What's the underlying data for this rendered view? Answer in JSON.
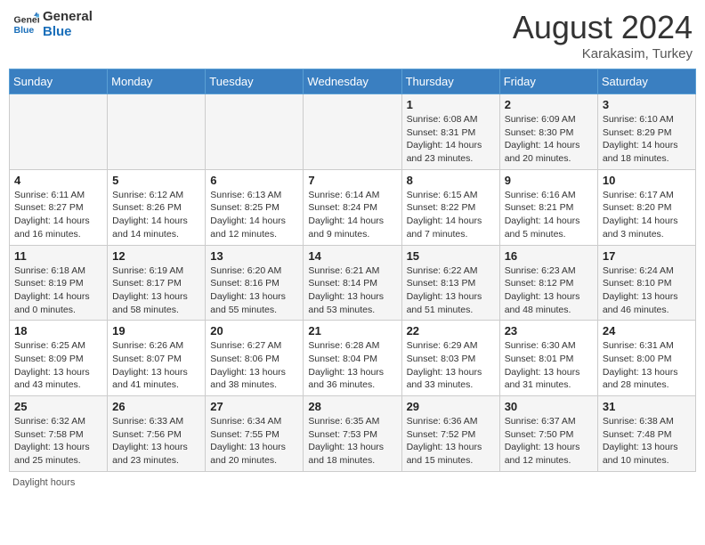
{
  "header": {
    "logo_line1": "General",
    "logo_line2": "Blue",
    "month_year": "August 2024",
    "location": "Karakasim, Turkey"
  },
  "days_of_week": [
    "Sunday",
    "Monday",
    "Tuesday",
    "Wednesday",
    "Thursday",
    "Friday",
    "Saturday"
  ],
  "weeks": [
    [
      {
        "day": "",
        "info": ""
      },
      {
        "day": "",
        "info": ""
      },
      {
        "day": "",
        "info": ""
      },
      {
        "day": "",
        "info": ""
      },
      {
        "day": "1",
        "info": "Sunrise: 6:08 AM\nSunset: 8:31 PM\nDaylight: 14 hours and 23 minutes."
      },
      {
        "day": "2",
        "info": "Sunrise: 6:09 AM\nSunset: 8:30 PM\nDaylight: 14 hours and 20 minutes."
      },
      {
        "day": "3",
        "info": "Sunrise: 6:10 AM\nSunset: 8:29 PM\nDaylight: 14 hours and 18 minutes."
      }
    ],
    [
      {
        "day": "4",
        "info": "Sunrise: 6:11 AM\nSunset: 8:27 PM\nDaylight: 14 hours and 16 minutes."
      },
      {
        "day": "5",
        "info": "Sunrise: 6:12 AM\nSunset: 8:26 PM\nDaylight: 14 hours and 14 minutes."
      },
      {
        "day": "6",
        "info": "Sunrise: 6:13 AM\nSunset: 8:25 PM\nDaylight: 14 hours and 12 minutes."
      },
      {
        "day": "7",
        "info": "Sunrise: 6:14 AM\nSunset: 8:24 PM\nDaylight: 14 hours and 9 minutes."
      },
      {
        "day": "8",
        "info": "Sunrise: 6:15 AM\nSunset: 8:22 PM\nDaylight: 14 hours and 7 minutes."
      },
      {
        "day": "9",
        "info": "Sunrise: 6:16 AM\nSunset: 8:21 PM\nDaylight: 14 hours and 5 minutes."
      },
      {
        "day": "10",
        "info": "Sunrise: 6:17 AM\nSunset: 8:20 PM\nDaylight: 14 hours and 3 minutes."
      }
    ],
    [
      {
        "day": "11",
        "info": "Sunrise: 6:18 AM\nSunset: 8:19 PM\nDaylight: 14 hours and 0 minutes."
      },
      {
        "day": "12",
        "info": "Sunrise: 6:19 AM\nSunset: 8:17 PM\nDaylight: 13 hours and 58 minutes."
      },
      {
        "day": "13",
        "info": "Sunrise: 6:20 AM\nSunset: 8:16 PM\nDaylight: 13 hours and 55 minutes."
      },
      {
        "day": "14",
        "info": "Sunrise: 6:21 AM\nSunset: 8:14 PM\nDaylight: 13 hours and 53 minutes."
      },
      {
        "day": "15",
        "info": "Sunrise: 6:22 AM\nSunset: 8:13 PM\nDaylight: 13 hours and 51 minutes."
      },
      {
        "day": "16",
        "info": "Sunrise: 6:23 AM\nSunset: 8:12 PM\nDaylight: 13 hours and 48 minutes."
      },
      {
        "day": "17",
        "info": "Sunrise: 6:24 AM\nSunset: 8:10 PM\nDaylight: 13 hours and 46 minutes."
      }
    ],
    [
      {
        "day": "18",
        "info": "Sunrise: 6:25 AM\nSunset: 8:09 PM\nDaylight: 13 hours and 43 minutes."
      },
      {
        "day": "19",
        "info": "Sunrise: 6:26 AM\nSunset: 8:07 PM\nDaylight: 13 hours and 41 minutes."
      },
      {
        "day": "20",
        "info": "Sunrise: 6:27 AM\nSunset: 8:06 PM\nDaylight: 13 hours and 38 minutes."
      },
      {
        "day": "21",
        "info": "Sunrise: 6:28 AM\nSunset: 8:04 PM\nDaylight: 13 hours and 36 minutes."
      },
      {
        "day": "22",
        "info": "Sunrise: 6:29 AM\nSunset: 8:03 PM\nDaylight: 13 hours and 33 minutes."
      },
      {
        "day": "23",
        "info": "Sunrise: 6:30 AM\nSunset: 8:01 PM\nDaylight: 13 hours and 31 minutes."
      },
      {
        "day": "24",
        "info": "Sunrise: 6:31 AM\nSunset: 8:00 PM\nDaylight: 13 hours and 28 minutes."
      }
    ],
    [
      {
        "day": "25",
        "info": "Sunrise: 6:32 AM\nSunset: 7:58 PM\nDaylight: 13 hours and 25 minutes."
      },
      {
        "day": "26",
        "info": "Sunrise: 6:33 AM\nSunset: 7:56 PM\nDaylight: 13 hours and 23 minutes."
      },
      {
        "day": "27",
        "info": "Sunrise: 6:34 AM\nSunset: 7:55 PM\nDaylight: 13 hours and 20 minutes."
      },
      {
        "day": "28",
        "info": "Sunrise: 6:35 AM\nSunset: 7:53 PM\nDaylight: 13 hours and 18 minutes."
      },
      {
        "day": "29",
        "info": "Sunrise: 6:36 AM\nSunset: 7:52 PM\nDaylight: 13 hours and 15 minutes."
      },
      {
        "day": "30",
        "info": "Sunrise: 6:37 AM\nSunset: 7:50 PM\nDaylight: 13 hours and 12 minutes."
      },
      {
        "day": "31",
        "info": "Sunrise: 6:38 AM\nSunset: 7:48 PM\nDaylight: 13 hours and 10 minutes."
      }
    ]
  ],
  "footer": {
    "text": "Daylight hours"
  }
}
